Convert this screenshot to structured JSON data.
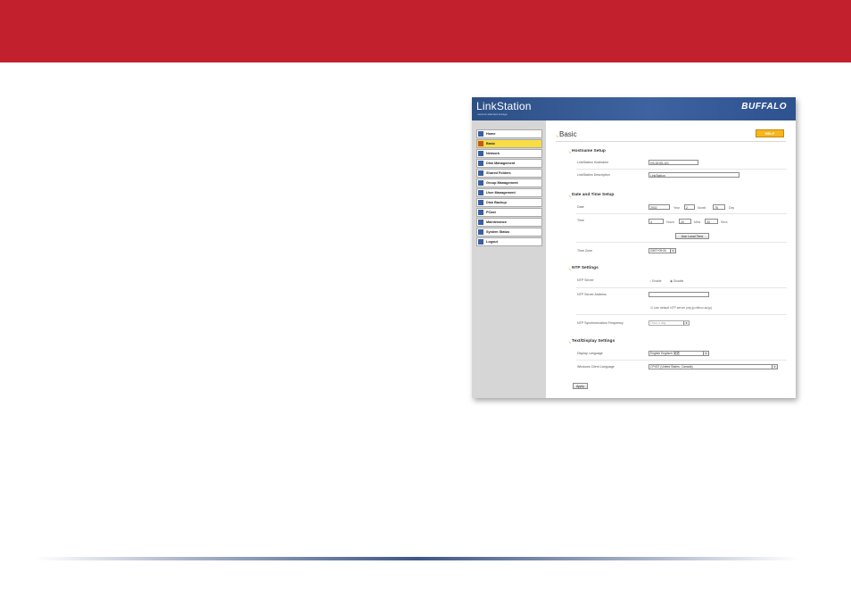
{
  "slide": {
    "header_color": "#c2202d"
  },
  "app": {
    "logo": "LinkStation",
    "tagline": "network attached storage",
    "brand": "BUFFALO"
  },
  "sidebar": {
    "items": [
      {
        "label": "Home"
      },
      {
        "label": "Basic",
        "active": true
      },
      {
        "label": "Network"
      },
      {
        "label": "Disk Management"
      },
      {
        "label": "Shared Folders"
      },
      {
        "label": "Group Management"
      },
      {
        "label": "User Management"
      },
      {
        "label": "Disk Backup"
      },
      {
        "label": "PCast"
      },
      {
        "label": "Maintenance"
      },
      {
        "label": "System Status"
      },
      {
        "label": "Logout"
      }
    ]
  },
  "page": {
    "title": "Basic",
    "help_label": "HELP"
  },
  "hostname": {
    "heading": "Hostname Setup",
    "name_label": "LinkStation Hostname",
    "name_value": "HS-DHGL101",
    "desc_label": "LinkStation Description",
    "desc_value": "LinkStation"
  },
  "datetime": {
    "heading": "Date and Time Setup",
    "date_label": "Date",
    "year_value": "2002",
    "year_unit": "Year",
    "month_value": "2",
    "month_unit": "Month",
    "day_value": "76",
    "day_unit": "Day",
    "time_label": "Time",
    "hour_value": "4",
    "hour_unit": "Hours",
    "min_value": "20",
    "min_unit": "Mins",
    "sec_value": "33",
    "sec_unit": "Secs",
    "local_time_button": "Use Local Time",
    "zone_label": "Time Zone",
    "zone_value": "GMT+09:00"
  },
  "ntp": {
    "heading": "NTP Settings",
    "server_label": "NTP Server",
    "enable_label": "Enable",
    "disable_label": "Disable",
    "address_label": "NTP Server Address",
    "address_value": "",
    "default_label": "Use default NTP server (ntp.jp.ntfbox.ad.jp)",
    "freq_label": "NTP Synchronization Frequency",
    "freq_value": "Once a day"
  },
  "text_display": {
    "heading": "Text/Display Settings",
    "lang_label": "Display Language",
    "lang_value": "English Englisch 英語",
    "client_label": "Windows Client Language",
    "client_value": "CP437 (United States, Canada)"
  },
  "actions": {
    "apply_label": "Apply"
  }
}
